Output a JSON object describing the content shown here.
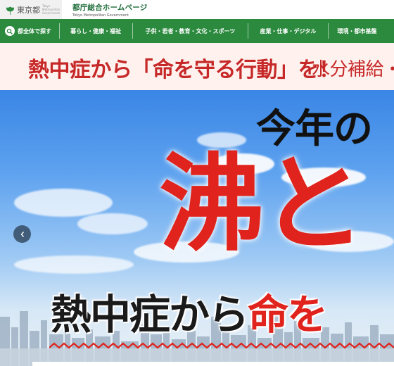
{
  "header": {
    "logo_text": "東京都",
    "logo_sub": "Tokyo Metropolitan Government",
    "site_title": "都庁総合ホームページ",
    "site_title_en": "Tokyo Metropolitan Government"
  },
  "nav": {
    "search_label": "都全体で探す",
    "items": [
      {
        "label": "暮らし・健康・福祉"
      },
      {
        "label": "子供・若者・教育・文化・スポーツ"
      },
      {
        "label": "産業・仕事・デジタル"
      },
      {
        "label": "環境・都市基盤"
      }
    ]
  },
  "banner": {
    "main_text": "熱中症から「命を守る行動」を！",
    "sub_text": "水分補給・"
  },
  "hero": {
    "line1": "今年の",
    "big": "沸と",
    "line3_black": "熱中症から",
    "line3_red": "命を",
    "prev_label": "‹"
  },
  "colors": {
    "nav_green": "#2b8a3e",
    "title_green": "#1f6e3b",
    "banner_red": "#c62828",
    "hero_red": "#e0231c"
  }
}
